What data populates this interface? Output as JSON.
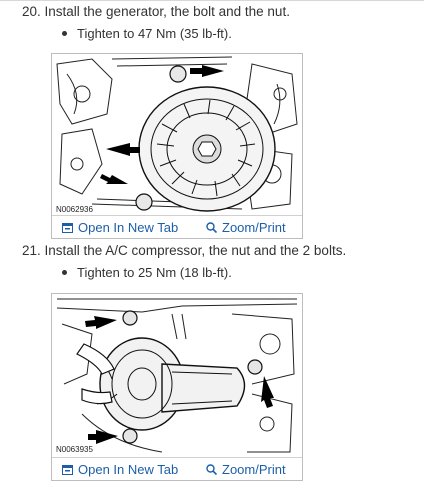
{
  "steps": [
    {
      "text": "20. Install the generator, the bolt and the nut.",
      "bullet": "Tighten to 47 Nm (35 lb-ft).",
      "figure": {
        "code": "N0062936",
        "open_tab": "Open In New Tab",
        "zoom": "Zoom/Print"
      }
    },
    {
      "text": "21. Install the A/C compressor, the nut and the 2 bolts.",
      "bullet": "Tighten to 25 Nm (18 lb-ft).",
      "figure": {
        "code": "N0063935",
        "open_tab": "Open In New Tab",
        "zoom": "Zoom/Print"
      }
    }
  ],
  "colors": {
    "link": "#1c5fa8",
    "text": "#333333",
    "border": "#bdbdbd"
  },
  "icons": {
    "open_tab": "open-new-tab-icon",
    "zoom": "magnifier-zoom-icon",
    "bullet": "bullet-dot-icon"
  }
}
